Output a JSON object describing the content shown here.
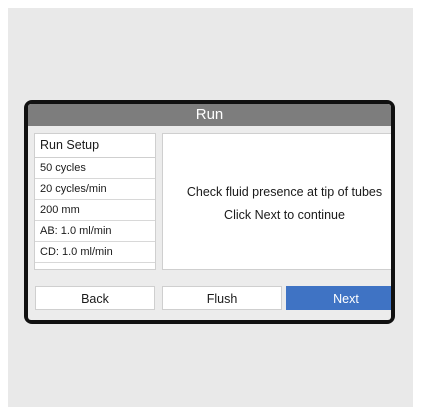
{
  "window": {
    "title": "Run"
  },
  "setup": {
    "header": "Run Setup",
    "items": [
      "50  cycles",
      "20  cycles/min",
      "200  mm",
      "AB: 1.0  ml/min",
      "CD: 1.0  ml/min"
    ]
  },
  "message": {
    "line1": "Check fluid presence at tip of tubes",
    "line2": "Click Next to continue"
  },
  "buttons": {
    "back": "Back",
    "flush": "Flush",
    "next": "Next"
  },
  "colors": {
    "title_bar": "#7d7d7d",
    "next_button": "#3f73c4",
    "bezel": "#111111"
  }
}
